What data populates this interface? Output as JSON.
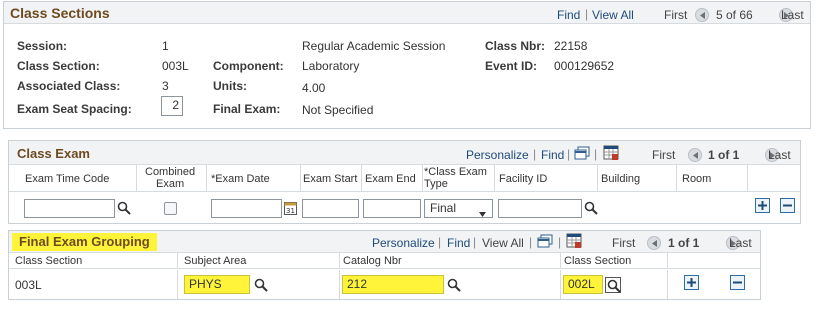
{
  "class_sections": {
    "title": "Class Sections",
    "find": "Find",
    "view_all": "View All",
    "first": "First",
    "page_info": "5 of 66",
    "last": "Last",
    "fields": {
      "session_label": "Session:",
      "session_value": "1",
      "session_desc": "Regular Academic Session",
      "class_nbr_label": "Class Nbr:",
      "class_nbr_value": "22158",
      "class_section_label": "Class Section:",
      "class_section_value": "003L",
      "component_label": "Component:",
      "component_value": "Laboratory",
      "event_id_label": "Event ID:",
      "event_id_value": "000129652",
      "associated_class_label": "Associated Class:",
      "associated_class_value": "3",
      "units_label": "Units:",
      "units_value": "4.00",
      "exam_seat_spacing_label": "Exam Seat Spacing:",
      "exam_seat_spacing_value": "2",
      "final_exam_label": "Final Exam:",
      "final_exam_value": "Not Specified"
    }
  },
  "class_exam": {
    "title": "Class Exam",
    "personalize": "Personalize",
    "find": "Find",
    "first": "First",
    "page_info": "1 of 1",
    "last": "Last",
    "columns": {
      "exam_time_code": "Exam Time Code",
      "combined_exam_1": "Combined",
      "combined_exam_2": "Exam",
      "exam_date": "*Exam Date",
      "exam_start": "Exam Start",
      "exam_end": "Exam End",
      "class_exam_type_1": "*Class Exam",
      "class_exam_type_2": "Type",
      "facility_id": "Facility ID",
      "building": "Building",
      "room": "Room"
    },
    "row": {
      "exam_time_code": "",
      "exam_date": "",
      "exam_start": "",
      "exam_end": "",
      "exam_type": "Final",
      "facility_id": ""
    }
  },
  "final_exam_grouping": {
    "title": "Final Exam Grouping",
    "personalize": "Personalize",
    "find": "Find",
    "view_all": "View All",
    "first": "First",
    "page_info": "1 of 1",
    "last": "Last",
    "columns": {
      "class_section": "Class Section",
      "subject_area": "Subject Area",
      "catalog_nbr": "Catalog Nbr",
      "class_section_2": "Class Section"
    },
    "row": {
      "class_section": "003L",
      "subject_area": "PHYS",
      "catalog_nbr": "212",
      "class_section_2": "002L"
    }
  },
  "colors": {
    "highlight": "#fff43a",
    "title": "#6e4b1f",
    "link": "#1f4b7a"
  }
}
